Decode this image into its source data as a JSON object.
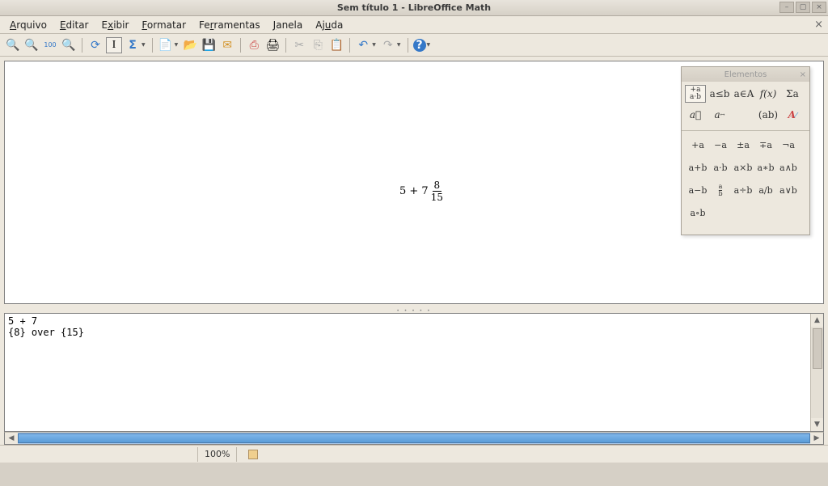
{
  "window": {
    "title": "Sem título 1 - LibreOffice Math"
  },
  "menu": {
    "arquivo": "Arquivo",
    "editar": "Editar",
    "exibir": "Exibir",
    "formatar": "Formatar",
    "ferramentas": "Ferramentas",
    "janela": "Janela",
    "ajuda": "Ajuda"
  },
  "toolbar": {
    "zoom_in": "🔍+",
    "zoom_out": "🔍-",
    "zoom_100": "100",
    "zoom_fit": "🔍",
    "refresh": "↻",
    "cursor": "I",
    "sigma": "Σ",
    "new": "📄",
    "open": "📂",
    "save": "💾",
    "mail": "✉",
    "pdf": "PDF",
    "print": "🖨",
    "cut": "✂",
    "copy": "📋",
    "paste": "📋",
    "undo": "↶",
    "redo": "↷",
    "help": "?"
  },
  "formula": {
    "left": "5 + 7",
    "num": "8",
    "den": "15"
  },
  "elements": {
    "title": "Elementos",
    "categories": {
      "unary": "+a\n⁄a·b",
      "relations": "a≤b",
      "sets": "a∈A",
      "functions": "f(x)",
      "operators": "Σa",
      "attributes": "ā⃗",
      "others": "ā↔",
      "brackets": "(ab)",
      "formats": "A"
    },
    "ops": {
      "r1": [
        "+a",
        "−a",
        "±a",
        "∓a",
        "¬a"
      ],
      "r2": [
        "a+b",
        "a·b",
        "a×b",
        "a∗b",
        "a∧b"
      ],
      "r3": [
        "a−b",
        "a⁄b",
        "a÷b",
        "a/b",
        "a∨b"
      ],
      "r4": [
        "a∘b"
      ]
    }
  },
  "command": {
    "text": "5 + 7\n{8} over {15}"
  },
  "statusbar": {
    "zoom": "100%"
  }
}
